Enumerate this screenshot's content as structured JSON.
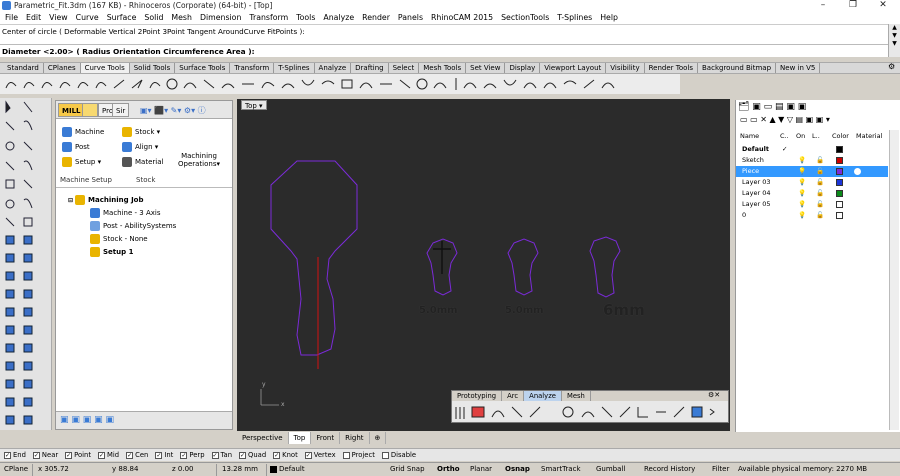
{
  "window": {
    "title": "Parametric_Fit.3dm (167 KB) - Rhinoceros (Corporate) (64-bit) - [Top]"
  },
  "menu": [
    "File",
    "Edit",
    "View",
    "Curve",
    "Surface",
    "Solid",
    "Mesh",
    "Dimension",
    "Transform",
    "Tools",
    "Analyze",
    "Render",
    "Panels",
    "RhinoCAM 2015",
    "SectionTools",
    "T-Splines",
    "Help"
  ],
  "command": {
    "history": "Center of circle ( Deformable  Vertical  2Point  3Point  Tangent  AroundCurve  FitPoints ):",
    "prompt": "Diameter <2.00> ( Radius  Orientation  Circumference  Area ):"
  },
  "toolbar_tabs": [
    "Standard",
    "CPlanes",
    "Curve Tools",
    "Solid Tools",
    "Surface Tools",
    "Transform",
    "T-Splines",
    "Analyze",
    "Drafting",
    "Select",
    "Mesh Tools",
    "Set View",
    "Display",
    "Viewport Layout",
    "Visibility",
    "Render Tools",
    "Background Bitmap",
    "New in V5"
  ],
  "toolbar_tabs_active": "Curve Tools",
  "cam": {
    "tabs": [
      "MILL",
      "Pro",
      "Sir"
    ],
    "machining_setup": {
      "machine": "Machine",
      "post": "Post",
      "setup": "Setup"
    },
    "stock_group": {
      "stock": "Stock",
      "align": "Align",
      "material": "Material"
    },
    "machining_operations": "Machining Operations",
    "group_labels": {
      "setup": "Machine Setup",
      "stock": "Stock"
    },
    "tree": {
      "job": "Machining Job",
      "machine": "Machine - 3 Axis",
      "post": "Post - AbilitySystems",
      "stock": "Stock - None",
      "setup": "Setup 1"
    }
  },
  "viewport": {
    "label": "Top",
    "dims": [
      "5.0mm",
      "5.0mm",
      "6mm"
    ],
    "axis_x": "x",
    "axis_y": "y",
    "tabs": [
      "Perspective",
      "Top",
      "Front",
      "Right"
    ],
    "active_tab": "Top"
  },
  "floating_toolbar": {
    "tabs": [
      "Prototyping",
      "Arc",
      "Analyze",
      "Mesh"
    ],
    "active": "Analyze"
  },
  "layers": {
    "headers": {
      "name": "Name",
      "c": "C..",
      "on": "On",
      "lock": "L..",
      "color": "Color",
      "material": "Material"
    },
    "rows": [
      {
        "name": "Default",
        "color": "#000000",
        "check": "✓",
        "bold": true
      },
      {
        "name": "Sketch",
        "color": "#cc0000"
      },
      {
        "name": "Piece",
        "color": "#7b2bd8",
        "selected": true
      },
      {
        "name": "Layer 03",
        "color": "#1b35d8"
      },
      {
        "name": "Layer 04",
        "color": "#0a8a1a"
      },
      {
        "name": "Layer 05",
        "color": "#ffffff"
      },
      {
        "name": "0",
        "color": "#ffffff"
      }
    ]
  },
  "osnap": {
    "items": [
      {
        "label": "End",
        "checked": true
      },
      {
        "label": "Near",
        "checked": true
      },
      {
        "label": "Point",
        "checked": true
      },
      {
        "label": "Mid",
        "checked": true
      },
      {
        "label": "Cen",
        "checked": true
      },
      {
        "label": "Int",
        "checked": true
      },
      {
        "label": "Perp",
        "checked": true
      },
      {
        "label": "Tan",
        "checked": true
      },
      {
        "label": "Quad",
        "checked": true
      },
      {
        "label": "Knot",
        "checked": true
      },
      {
        "label": "Vertex",
        "checked": true
      },
      {
        "label": "Project",
        "checked": false
      },
      {
        "label": "Disable",
        "checked": false
      }
    ]
  },
  "status": {
    "cplane": "CPlane",
    "x": "x 305.72",
    "y": "y 88.84",
    "z": "z 0.00",
    "units": "13.28 mm",
    "layer": "Default",
    "grid_snap": "Grid Snap",
    "ortho": "Ortho",
    "planar": "Planar",
    "osnap": "Osnap",
    "smarttrack": "SmartTrack",
    "gumball": "Gumball",
    "record_history": "Record History",
    "filter": "Filter",
    "memory": "Available physical memory: 2270 MB"
  }
}
